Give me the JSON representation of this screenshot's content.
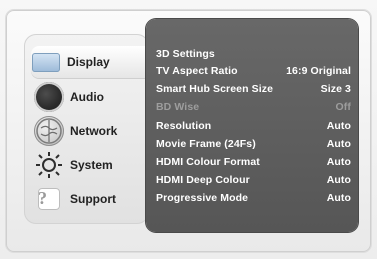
{
  "sidebar": {
    "items": [
      {
        "label": "Display",
        "icon": "display-icon"
      },
      {
        "label": "Audio",
        "icon": "audio-icon"
      },
      {
        "label": "Network",
        "icon": "network-icon"
      },
      {
        "label": "System",
        "icon": "system-icon"
      },
      {
        "label": "Support",
        "icon": "support-icon"
      }
    ]
  },
  "main": {
    "rows": [
      {
        "label": "3D Settings",
        "value": ""
      },
      {
        "label": "TV Aspect Ratio",
        "value": "16:9 Original"
      },
      {
        "label": "Smart Hub Screen Size",
        "value": "Size 3"
      },
      {
        "label": "BD Wise",
        "value": "Off",
        "disabled": true
      },
      {
        "label": "Resolution",
        "value": "Auto"
      },
      {
        "label": "Movie Frame (24Fs)",
        "value": "Auto"
      },
      {
        "label": "HDMI Colour Format",
        "value": "Auto"
      },
      {
        "label": "HDMI Deep Colour",
        "value": "Auto"
      },
      {
        "label": "Progressive Mode",
        "value": "Auto"
      }
    ]
  },
  "colors": {
    "panel": "#5f5f5f",
    "text": "#ffffff",
    "disabled_text": "#9d9d9d"
  }
}
